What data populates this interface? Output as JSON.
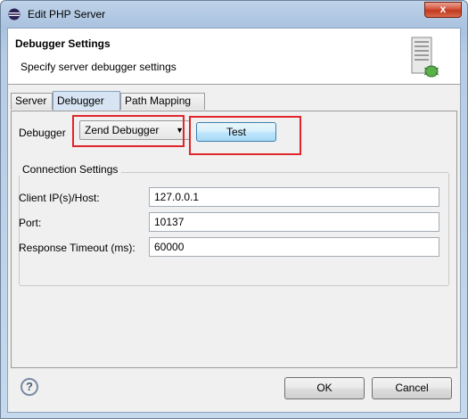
{
  "window": {
    "title": "Edit PHP Server",
    "close_glyph": "x"
  },
  "header": {
    "title": "Debugger Settings",
    "description": "Specify server debugger settings",
    "icon": "server-bug-icon"
  },
  "tabs": [
    {
      "label": "Server",
      "active": false
    },
    {
      "label": "Debugger",
      "active": true
    },
    {
      "label": "Path Mapping",
      "active": false
    }
  ],
  "debugger": {
    "label": "Debugger",
    "selected": "Zend Debugger",
    "test_label": "Test"
  },
  "connection": {
    "group_label": "Connection Settings",
    "fields": [
      {
        "label": "Client IP(s)/Host:",
        "value": "127.0.0.1"
      },
      {
        "label": "Port:",
        "value": "10137"
      },
      {
        "label": "Response Timeout (ms):",
        "value": "60000"
      }
    ]
  },
  "footer": {
    "help_glyph": "?",
    "ok_label": "OK",
    "cancel_label": "Cancel"
  },
  "colors": {
    "highlight_box": "#e0262b",
    "accent": "#3c7fb1"
  }
}
